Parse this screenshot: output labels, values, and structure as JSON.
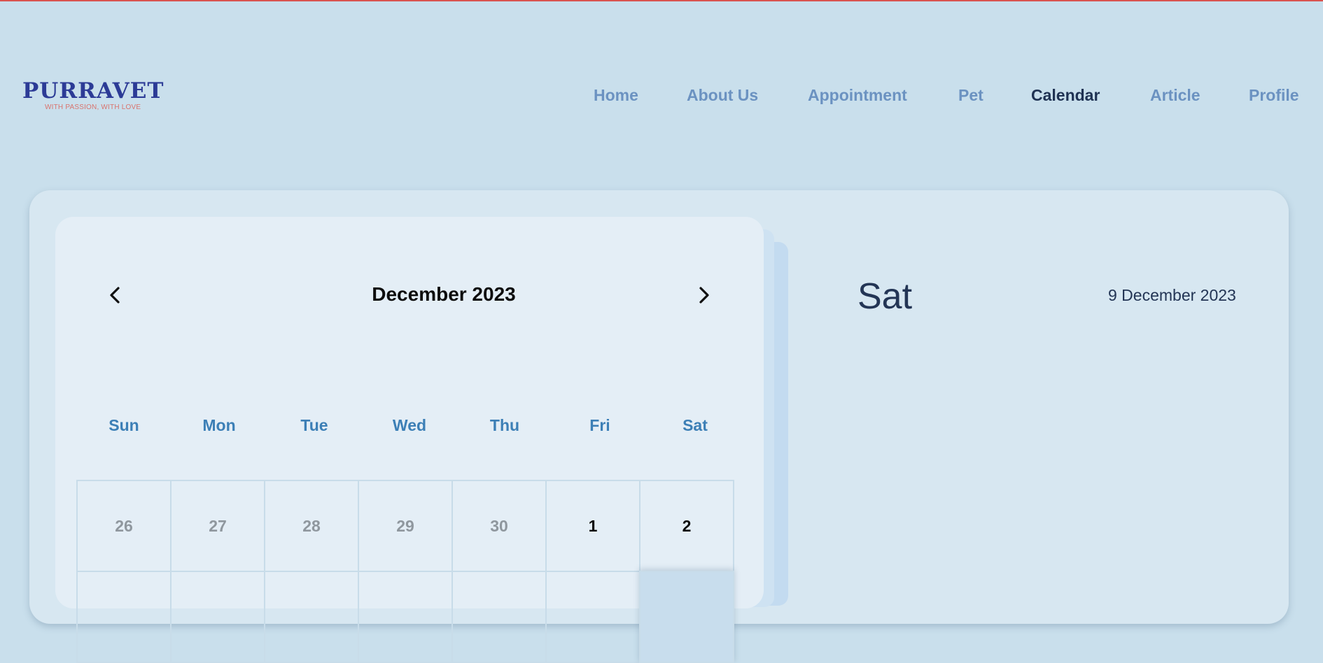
{
  "header": {
    "logo_title": "PURRAVET",
    "logo_tagline": "WITH PASSION, WITH LOVE",
    "brand_color": "#2c3b96",
    "nav": [
      {
        "label": "Home",
        "active": false
      },
      {
        "label": "About Us",
        "active": false
      },
      {
        "label": "Appointment",
        "active": false
      },
      {
        "label": "Pet",
        "active": false
      },
      {
        "label": "Calendar",
        "active": true
      },
      {
        "label": "Article",
        "active": false
      },
      {
        "label": "Profile",
        "active": false
      }
    ]
  },
  "calendar": {
    "month_label": "December 2023",
    "prev_icon": "chevron-left-icon",
    "next_icon": "chevron-right-icon",
    "weekdays": [
      "Sun",
      "Mon",
      "Tue",
      "Wed",
      "Thu",
      "Fri",
      "Sat"
    ],
    "weeks": [
      [
        {
          "d": "26",
          "muted": true
        },
        {
          "d": "27",
          "muted": true
        },
        {
          "d": "28",
          "muted": true
        },
        {
          "d": "29",
          "muted": true
        },
        {
          "d": "30",
          "muted": true
        },
        {
          "d": "1",
          "muted": false
        },
        {
          "d": "2",
          "muted": false
        }
      ],
      [
        {
          "d": "",
          "muted": false
        },
        {
          "d": "",
          "muted": false
        },
        {
          "d": "",
          "muted": false
        },
        {
          "d": "",
          "muted": false
        },
        {
          "d": "",
          "muted": false
        },
        {
          "d": "",
          "muted": false
        },
        {
          "d": "",
          "muted": false,
          "selected": true
        }
      ]
    ]
  },
  "selected_day": {
    "weekday": "Sat",
    "full_date": "9 December 2023"
  }
}
